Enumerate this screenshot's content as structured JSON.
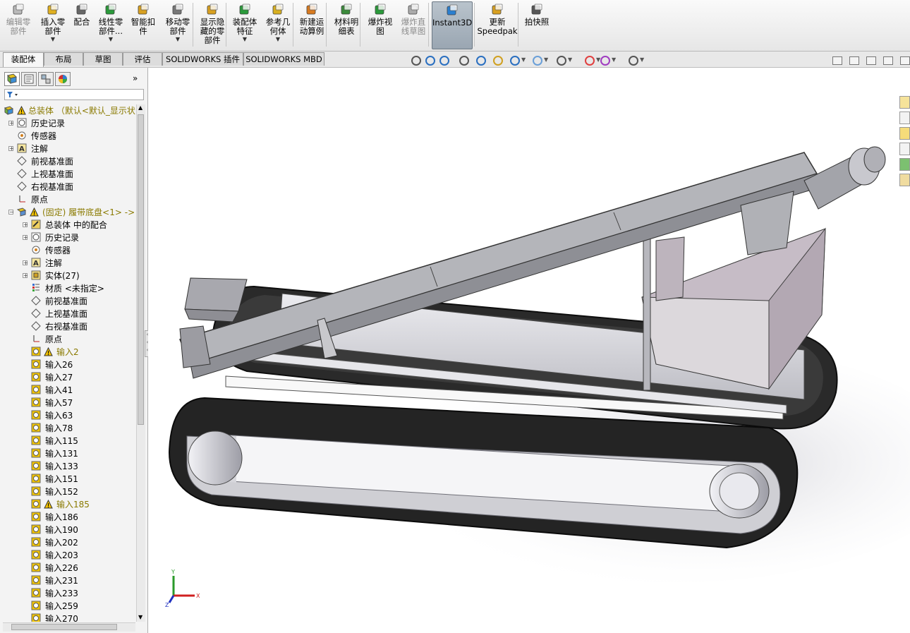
{
  "ribbon": {
    "buttons": [
      {
        "label": "编辑零\n部件",
        "icon": "edit-component-icon",
        "state": "disabled"
      },
      {
        "label": "插入零\n部件",
        "icon": "insert-component-icon",
        "dropdown": true
      },
      {
        "label": "配合",
        "icon": "mate-icon"
      },
      {
        "label": "线性零\n部件...",
        "icon": "linear-pattern-icon",
        "dropdown": true
      },
      {
        "label": "智能扣\n件",
        "icon": "smart-fasteners-icon"
      },
      {
        "label": "移动零\n部件",
        "icon": "move-component-icon",
        "dropdown": true
      },
      {
        "label": "显示隐\n藏的零\n部件",
        "icon": "show-hidden-components-icon"
      },
      {
        "label": "装配体\n特征",
        "icon": "assembly-features-icon",
        "dropdown": true
      },
      {
        "label": "参考几\n何体",
        "icon": "reference-geometry-icon",
        "dropdown": true
      },
      {
        "label": "新建运\n动算例",
        "icon": "new-motion-study-icon"
      },
      {
        "label": "材料明\n细表",
        "icon": "bill-of-materials-icon"
      },
      {
        "label": "爆炸视\n图",
        "icon": "exploded-view-icon"
      },
      {
        "label": "爆炸直\n线草图",
        "icon": "explode-line-sketch-icon",
        "state": "disabled"
      },
      {
        "label": "Instant3D",
        "icon": "instant3d-icon",
        "state": "active"
      },
      {
        "label": "更新\nSpeedpak",
        "icon": "update-speedpak-icon"
      },
      {
        "label": "拍快照",
        "icon": "snapshot-icon"
      }
    ]
  },
  "tabs": [
    "装配体",
    "布局",
    "草图",
    "评估",
    "SOLIDWORKS 插件",
    "SOLIDWORKS MBD"
  ],
  "active_tab": "装配体",
  "heads_up_toolbar": [
    "view-orientation-icon",
    "zoom-to-fit-icon",
    "zoom-to-area-icon",
    "previous-view-icon",
    "section-view-icon",
    "dynamic-annotation-icon",
    "view-orientation-dd-icon",
    "display-style-icon",
    "hide-show-items-icon",
    "edit-appearance-icon",
    "apply-scene-icon",
    "view-settings-icon"
  ],
  "tree": {
    "root_label": "总装体 （默认<默认_显示状",
    "nodes": [
      {
        "label": "历史记录",
        "level": 0,
        "expander": "+",
        "icon": "history-icon"
      },
      {
        "label": "传感器",
        "level": 0,
        "expander": "",
        "icon": "sensor-icon"
      },
      {
        "label": "注解",
        "level": 0,
        "expander": "+",
        "icon": "annotation-icon"
      },
      {
        "label": "前视基准面",
        "level": 0,
        "expander": "",
        "icon": "plane-icon"
      },
      {
        "label": "上视基准面",
        "level": 0,
        "expander": "",
        "icon": "plane-icon"
      },
      {
        "label": "右视基准面",
        "level": 0,
        "expander": "",
        "icon": "plane-icon"
      },
      {
        "label": "原点",
        "level": 0,
        "expander": "",
        "icon": "origin-icon"
      },
      {
        "label": "(固定) 履带底盘<1> ->",
        "level": 0,
        "expander": "−",
        "icon": "subassembly-warning-icon",
        "warn": true
      },
      {
        "label": "总装体 中的配合",
        "level": 1,
        "expander": "+",
        "icon": "mates-icon"
      },
      {
        "label": "历史记录",
        "level": 1,
        "expander": "+",
        "icon": "history-icon"
      },
      {
        "label": "传感器",
        "level": 1,
        "expander": "",
        "icon": "sensor-icon"
      },
      {
        "label": "注解",
        "level": 1,
        "expander": "+",
        "icon": "annotation-icon"
      },
      {
        "label": "实体(27)",
        "level": 1,
        "expander": "+",
        "icon": "solid-bodies-icon"
      },
      {
        "label": "材质 <未指定>",
        "level": 1,
        "expander": "",
        "icon": "material-icon"
      },
      {
        "label": "前视基准面",
        "level": 1,
        "expander": "",
        "icon": "plane-icon"
      },
      {
        "label": "上视基准面",
        "level": 1,
        "expander": "",
        "icon": "plane-icon"
      },
      {
        "label": "右视基准面",
        "level": 1,
        "expander": "",
        "icon": "plane-icon"
      },
      {
        "label": "原点",
        "level": 1,
        "expander": "",
        "icon": "origin-icon"
      },
      {
        "label": "输入2",
        "level": 1,
        "expander": "",
        "icon": "imported-body-icon",
        "warn": true
      },
      {
        "label": "输入26",
        "level": 1,
        "expander": "",
        "icon": "imported-body-icon"
      },
      {
        "label": "输入27",
        "level": 1,
        "expander": "",
        "icon": "imported-body-icon"
      },
      {
        "label": "输入41",
        "level": 1,
        "expander": "",
        "icon": "imported-body-icon"
      },
      {
        "label": "输入57",
        "level": 1,
        "expander": "",
        "icon": "imported-body-icon"
      },
      {
        "label": "输入63",
        "level": 1,
        "expander": "",
        "icon": "imported-body-icon"
      },
      {
        "label": "输入78",
        "level": 1,
        "expander": "",
        "icon": "imported-body-icon"
      },
      {
        "label": "输入115",
        "level": 1,
        "expander": "",
        "icon": "imported-body-icon"
      },
      {
        "label": "输入131",
        "level": 1,
        "expander": "",
        "icon": "imported-body-icon"
      },
      {
        "label": "输入133",
        "level": 1,
        "expander": "",
        "icon": "imported-body-icon"
      },
      {
        "label": "输入151",
        "level": 1,
        "expander": "",
        "icon": "imported-body-icon"
      },
      {
        "label": "输入152",
        "level": 1,
        "expander": "",
        "icon": "imported-body-icon"
      },
      {
        "label": "输入185",
        "level": 1,
        "expander": "",
        "icon": "imported-body-icon",
        "warn": true
      },
      {
        "label": "输入186",
        "level": 1,
        "expander": "",
        "icon": "imported-body-icon"
      },
      {
        "label": "输入190",
        "level": 1,
        "expander": "",
        "icon": "imported-body-icon"
      },
      {
        "label": "输入202",
        "level": 1,
        "expander": "",
        "icon": "imported-body-icon"
      },
      {
        "label": "输入203",
        "level": 1,
        "expander": "",
        "icon": "imported-body-icon"
      },
      {
        "label": "输入226",
        "level": 1,
        "expander": "",
        "icon": "imported-body-icon"
      },
      {
        "label": "输入231",
        "level": 1,
        "expander": "",
        "icon": "imported-body-icon"
      },
      {
        "label": "输入233",
        "level": 1,
        "expander": "",
        "icon": "imported-body-icon"
      },
      {
        "label": "输入259",
        "level": 1,
        "expander": "",
        "icon": "imported-body-icon"
      },
      {
        "label": "输入270",
        "level": 1,
        "expander": "",
        "icon": "imported-body-icon"
      }
    ]
  },
  "triad": {
    "x": "X",
    "y": "Y",
    "z": "Z"
  },
  "colors": {
    "track": "#1e1e1e",
    "frame": "#cfcfd4",
    "conveyor": "#a9aaaf",
    "hopper": "#c6bcc6",
    "warning": "#f2c200",
    "accent_active": "#9aa6b2"
  }
}
